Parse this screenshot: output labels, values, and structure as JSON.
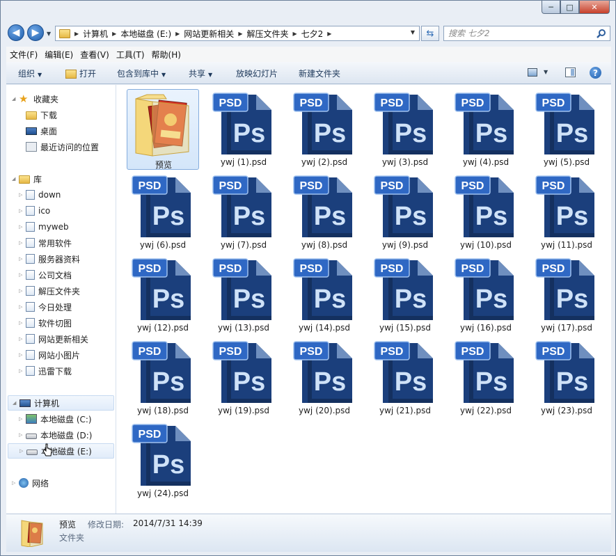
{
  "caption": {
    "minimize": "─",
    "maximize": "□",
    "close": "✕"
  },
  "address": {
    "crumbs": [
      "计算机",
      "本地磁盘 (E:)",
      "网站更新相关",
      "解压文件夹",
      "七夕2"
    ],
    "search_placeholder": "搜索 七夕2"
  },
  "menu": [
    "文件(F)",
    "编辑(E)",
    "查看(V)",
    "工具(T)",
    "帮助(H)"
  ],
  "commands": {
    "organize": "组织",
    "open": "打开",
    "include": "包含到库中",
    "share": "共享",
    "slideshow": "放映幻灯片",
    "new_folder": "新建文件夹"
  },
  "nav": {
    "favorites": {
      "label": "收藏夹",
      "items": [
        "下载",
        "桌面",
        "最近访问的位置"
      ]
    },
    "libraries": {
      "label": "库",
      "items": [
        "down",
        "ico",
        "myweb",
        "常用软件",
        "服务器资料",
        "公司文档",
        "解压文件夹",
        "今日处理",
        "软件切图",
        "网站更新相关",
        "网站小图片",
        "迅雷下载"
      ]
    },
    "computer": {
      "label": "计算机",
      "items": [
        "本地磁盘 (C:)",
        "本地磁盘 (D:)",
        "本地磁盘 (E:)"
      ]
    },
    "network": {
      "label": "网络"
    }
  },
  "files": {
    "folder": "预览",
    "psd_badge": "PSD",
    "ps_text": "Ps",
    "items": [
      "ywj (1).psd",
      "ywj (2).psd",
      "ywj (3).psd",
      "ywj (4).psd",
      "ywj (5).psd",
      "ywj (6).psd",
      "ywj (7).psd",
      "ywj (8).psd",
      "ywj (9).psd",
      "ywj (10).psd",
      "ywj (11).psd",
      "ywj (12).psd",
      "ywj (13).psd",
      "ywj (14).psd",
      "ywj (15).psd",
      "ywj (16).psd",
      "ywj (17).psd",
      "ywj (18).psd",
      "ywj (19).psd",
      "ywj (20).psd",
      "ywj (21).psd",
      "ywj (22).psd",
      "ywj (23).psd",
      "ywj (24).psd"
    ]
  },
  "details": {
    "name": "预览",
    "modified_label": "修改日期:",
    "modified_value": "2014/7/31 14:39",
    "type": "文件夹"
  },
  "colors": {
    "ps_blue": "#1b3f7c",
    "ps_text": "#cfe2f8",
    "selection": "#d4e6fa"
  }
}
